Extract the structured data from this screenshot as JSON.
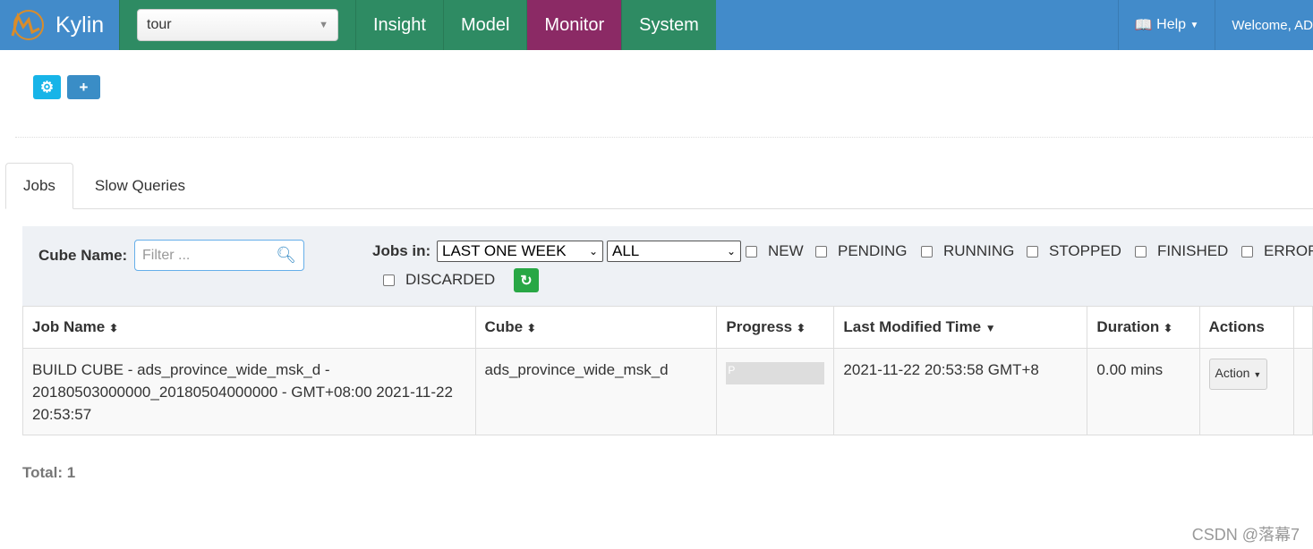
{
  "nav": {
    "brand": "Kylin",
    "project": "tour",
    "items": [
      "Insight",
      "Model",
      "Monitor",
      "System"
    ],
    "active": "Monitor",
    "help": "Help",
    "welcome": "Welcome, AD"
  },
  "colors": {
    "nav": "#428bca",
    "navitem": "#2e8b63",
    "active": "#8b2a65"
  },
  "tabs": [
    "Jobs",
    "Slow Queries"
  ],
  "filter": {
    "cube_name_label": "Cube Name:",
    "cube_placeholder": "Filter ...",
    "jobs_in_label": "Jobs in:",
    "time_range": "LAST ONE WEEK",
    "job_type": "ALL",
    "statuses": [
      "NEW",
      "PENDING",
      "RUNNING",
      "STOPPED",
      "FINISHED",
      "ERROR",
      "DISCARDED"
    ]
  },
  "table": {
    "headers": [
      "Job Name",
      "Cube",
      "Progress",
      "Last Modified Time",
      "Duration",
      "Actions"
    ],
    "rows": [
      {
        "job_name": "BUILD CUBE - ads_province_wide_msk_d - 20180503000000_20180504000000 - GMT+08:00 2021-11-22 20:53:57",
        "cube": "ads_province_wide_msk_d",
        "progress_label": "P",
        "progress": 0,
        "last_modified": "2021-11-22 20:53:58 GMT+8",
        "duration": "0.00 mins",
        "action": "Action"
      }
    ]
  },
  "total": "Total: 1",
  "watermark": "CSDN @落幕7"
}
